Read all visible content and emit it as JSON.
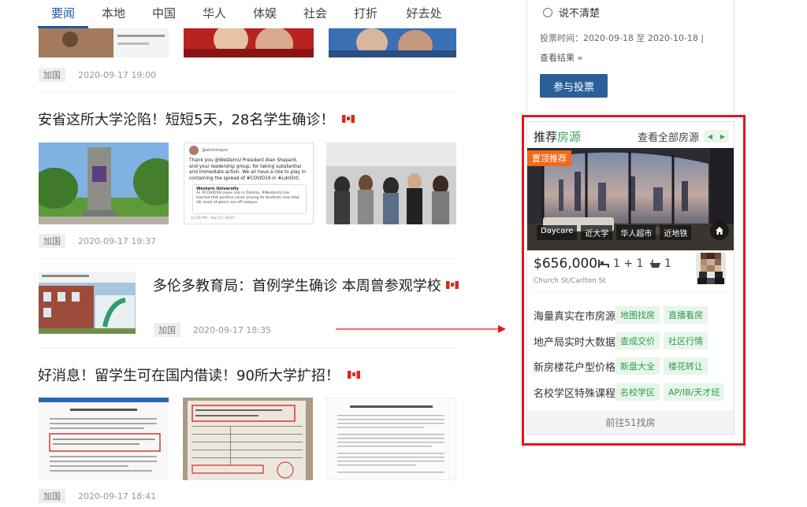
{
  "nav": [
    "要闻",
    "本地",
    "中国",
    "华人",
    "体娱",
    "社会",
    "打折",
    "好去处"
  ],
  "articles": [
    {
      "tag": "加国",
      "date": "2020-09-17 19:00"
    },
    {
      "headline": "安省这所大学沦陷！短短5天，28名学生确诊！",
      "tag": "加国",
      "date": "2020-09-17 19:37"
    },
    {
      "headline": "多伦多教育局：首例学生确诊 本周曾参观学校",
      "tag": "加国",
      "date": "2020-09-17 18:35"
    },
    {
      "headline": "好消息！留学生可在国内借读！90所大学扩招！",
      "tag": "加国",
      "date": "2020-09-17 18:41"
    }
  ],
  "tweet_text": {
    "handle": "@ahmimayor",
    "line1": "Thank you @WesternU President Alan Shepard,",
    "line2": "and your leadership group, for taking substantial",
    "line3": "and immediate action. We all have a role to play in",
    "line4": "containing the spread of #COVID19 in #LdnOnt.",
    "quote_name": "Western University",
    "quote_body": "As #COVID19 cases rise in Ontario, #WesternU has learned that positive cases among its students now total 28, most of whom are off campus.",
    "time": "12:56 PM · Sep 17, 2020"
  },
  "vote": {
    "option": "说不清楚",
    "time": "投票时间：2020-09-18 至 2020-10-18 |",
    "result": "查看结果 »",
    "button": "参与投票"
  },
  "house": {
    "title": "推荐",
    "title_accent": "房源",
    "see_all": "查看全部房源",
    "badge": "置顶推荐",
    "chips": [
      "Daycare",
      "近大学",
      "华人超市",
      "近地铁"
    ],
    "price": "$656,000",
    "bed": "1 + 1",
    "bath": "1",
    "address": "Church St/Carlton St",
    "services": [
      {
        "label": "海量真实在市房源",
        "tags": [
          "地图找房",
          "直播看房"
        ]
      },
      {
        "label": "地产局实时大数据",
        "tags": [
          "查成交价",
          "社区行情"
        ]
      },
      {
        "label": "新房楼花户型价格",
        "tags": [
          "新盘大全",
          "楼花转让"
        ]
      },
      {
        "label": "名校学区特殊课程",
        "tags": [
          "名校学区",
          "AP/IB/天才班"
        ]
      }
    ],
    "footer": "前往51找房"
  },
  "colors": {
    "accent": "#1e5aa8",
    "green": "#3da55c",
    "highlight": "#e8141b",
    "badge": "#f06a1c"
  }
}
